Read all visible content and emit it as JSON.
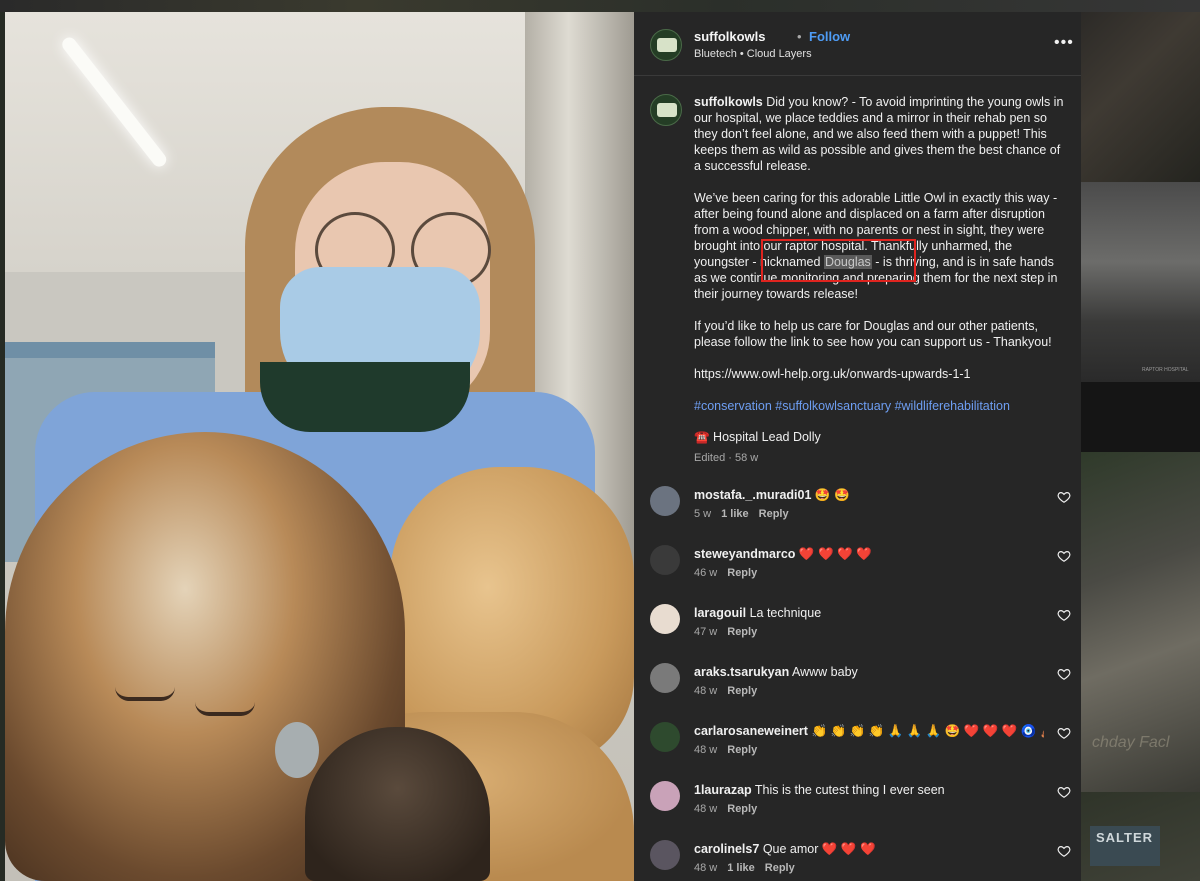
{
  "post": {
    "username": "suffolkowls",
    "dot": "•",
    "follow_label": "Follow",
    "audio": "Bluetech • Cloud Layers",
    "more_label": "•••"
  },
  "caption": {
    "username": "suffolkowls",
    "p1": "Did you know? - To avoid imprinting the young owls in our hospital, we place teddies and a mirror in their rehab pen so they don’t feel alone, and we also feed them with a puppet! This keeps them as wild as possible and gives them the best chance of a successful release.",
    "p2_before": "We’ve been caring for this adorable Little Owl in exactly this way - after being found alone and displaced on a farm after disruption from a wood chipper, with no parents or nest in sight, they were brought into our raptor hospital. Thankfully unharmed, the youngster - nicknamed ",
    "p2_highlight": "Douglas",
    "p2_after": " - is thriving, and is in safe hands as we continue monitoring and preparing them for the next step in their journey towards release!",
    "p3": "If you’d like to help us care for Douglas and our other patients, please follow the link to see how you can support us - Thankyou!",
    "link": "https://www.owl-help.org.uk/onwards-upwards-1-1",
    "tags": "#conservation #suffolkowlsanctuary #wildliferehabilitation",
    "signoff": "☎️ Hospital Lead Dolly",
    "edited": "Edited · 58 w"
  },
  "comments": [
    {
      "user": "mostafa._.muradi01",
      "text": "🤩 🤩",
      "time": "5 w",
      "likes": "1 like",
      "reply": "Reply",
      "avatar_color": "#6b7380"
    },
    {
      "user": "steweyandmarco",
      "text": "❤️ ❤️ ❤️ ❤️",
      "time": "46 w",
      "likes": "",
      "reply": "Reply",
      "avatar_color": "#3a3a3a"
    },
    {
      "user": "laragouil",
      "text": "La technique",
      "time": "47 w",
      "likes": "",
      "reply": "Reply",
      "avatar_color": "#e8dcd0"
    },
    {
      "user": "araks.tsarukyan",
      "text": "Awww baby",
      "time": "48 w",
      "likes": "",
      "reply": "Reply",
      "avatar_color": "#7a7a7a"
    },
    {
      "user": "carlarosaneweinert",
      "text": "👏 👏 👏 👏 🙏 🙏 🙏 🤩 ❤️ ❤️ ❤️ 🧿 🧸",
      "time": "48 w",
      "likes": "",
      "reply": "Reply",
      "avatar_color": "#2e4a2e"
    },
    {
      "user": "1laurazap",
      "text": "This is the cutest thing I ever seen",
      "time": "48 w",
      "likes": "",
      "reply": "Reply",
      "avatar_color": "#c9a2b8"
    },
    {
      "user": "carolinels7",
      "text": "Que amor ❤️ ❤️ ❤️",
      "time": "48 w",
      "likes": "1 like",
      "reply": "Reply",
      "avatar_color": "#5a5560"
    }
  ],
  "backdrop": {
    "salter": "SALTER",
    "faint": "chday Facl",
    "tiny": "RAPTOR HOSPITAL"
  }
}
